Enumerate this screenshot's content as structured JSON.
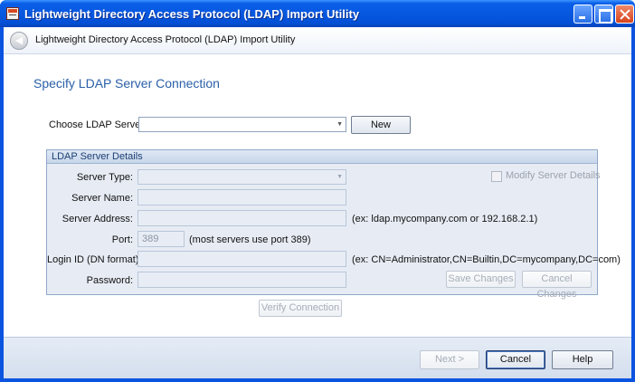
{
  "window": {
    "title": "Lightweight Directory Access Protocol (LDAP) Import Utility"
  },
  "nav": {
    "title": "Lightweight Directory Access Protocol (LDAP) Import Utility"
  },
  "page": {
    "heading": "Specify LDAP Server Connection"
  },
  "server_choice": {
    "label": "Choose LDAP Server:",
    "value": "",
    "new_button": "New"
  },
  "details": {
    "title": "LDAP Server Details",
    "modify_label": "Modify Server Details",
    "modify_checked": false,
    "server_type_label": "Server Type:",
    "server_type_value": "",
    "server_name_label": "Server Name:",
    "server_address_label": "Server Address:",
    "server_address_hint": "(ex: ldap.mycompany.com or 192.168.2.1)",
    "port_label": "Port:",
    "port_value": "389",
    "port_hint": "(most servers use port 389)",
    "login_label": "Login ID (DN format):",
    "login_hint": "(ex: CN=Administrator,CN=Builtin,DC=mycompany,DC=com)",
    "password_label": "Password:",
    "save_button": "Save Changes",
    "cancel_changes_button": "Cancel Changes"
  },
  "verify_button": "Verify Connection",
  "footer": {
    "next_button": "Next >",
    "cancel_button": "Cancel",
    "help_button": "Help"
  },
  "colors": {
    "titlebar": "#0758e0",
    "heading": "#2a5fa8",
    "group_bg": "#e7ecf4",
    "footer_bg": "#d3deed"
  }
}
